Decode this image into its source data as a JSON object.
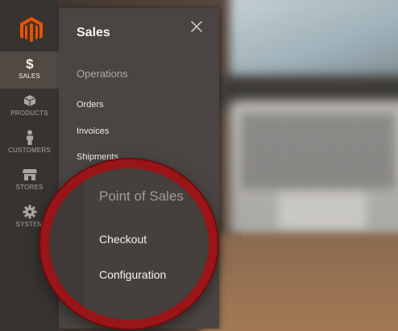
{
  "nav": {
    "items": [
      {
        "label": "SALES",
        "icon": "dollar-icon"
      },
      {
        "label": "PRODUCTS",
        "icon": "cube-icon"
      },
      {
        "label": "CUSTOMERS",
        "icon": "person-icon"
      },
      {
        "label": "STORES",
        "icon": "store-icon"
      },
      {
        "label": "SYSTEM",
        "icon": "gear-icon"
      }
    ]
  },
  "panel": {
    "title": "Sales",
    "groups": [
      {
        "title": "Operations",
        "links": [
          "Orders",
          "Invoices",
          "Shipments"
        ]
      },
      {
        "title": "Point of Sales",
        "links": [
          "Checkout",
          "Configuration"
        ]
      }
    ]
  },
  "colors": {
    "brand": "#eb5202",
    "rail": "#373330",
    "panel": "#4a4542",
    "highlight_ring": "#9a1517"
  }
}
